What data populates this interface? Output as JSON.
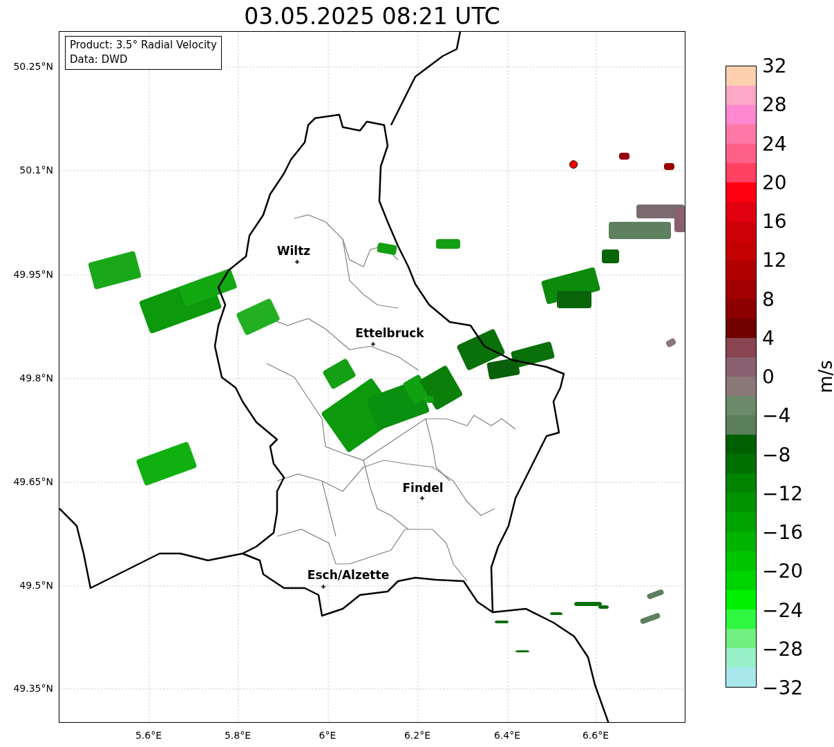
{
  "title": "03.05.2025 08:21 UTC",
  "info_box": [
    "Product: 3.5° Radial Velocity",
    "Data: DWD"
  ],
  "lat_ticks": [
    "50.25°N",
    "50.1°N",
    "49.95°N",
    "49.8°N",
    "49.65°N",
    "49.5°N",
    "49.35°N"
  ],
  "lon_ticks": [
    "5.6°E",
    "5.8°E",
    "6°E",
    "6.2°E",
    "6.4°E",
    "6.6°E"
  ],
  "cities": [
    {
      "name": "Wiltz"
    },
    {
      "name": "Ettelbruck"
    },
    {
      "name": "Findel"
    },
    {
      "name": "Esch/Alzette"
    }
  ],
  "colorbar": {
    "label": "m/s",
    "ticks": [
      "32",
      "28",
      "24",
      "20",
      "16",
      "12",
      "8",
      "4",
      "0",
      "−4",
      "−8",
      "−12",
      "−16",
      "−20",
      "−24",
      "−28",
      "−32"
    ]
  }
}
